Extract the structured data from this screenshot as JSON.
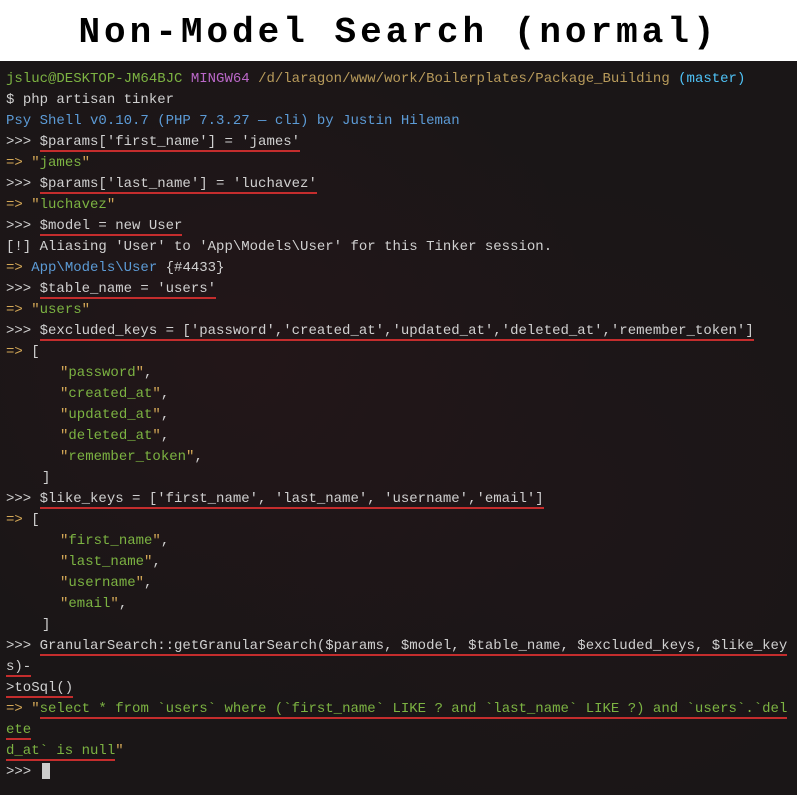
{
  "title": "Non-Model Search (normal)",
  "prompt": {
    "user": "jsluc@DESKTOP-JM64BJC",
    "system": "MINGW64",
    "path": "/d/laragon/www/work/Boilerplates/Package_Building",
    "branch": "(master)"
  },
  "cmd_prefix": "$ ",
  "cmd": "php artisan tinker",
  "psy_shell": "Psy Shell v0.10.7 (PHP 7.3.27 — cli) by Justin Hileman",
  "repl_prompt": ">>> ",
  "arrow": "=> ",
  "lines": {
    "l1": "$params['first_name'] = 'james'",
    "l1r_open": "\"",
    "l1r_val": "james",
    "l1r_close": "\"",
    "l2": "$params['last_name'] = 'luchavez'",
    "l2r_val": "luchavez",
    "l3": "$model = new User",
    "alias_prefix": "[!] ",
    "alias": "Aliasing 'User' to 'App\\Models\\User' for this Tinker session.",
    "l3r_class": "App\\Models\\User",
    "l3r_id": " {#4433}",
    "l4": "$table_name = 'users'",
    "l4r_val": "users",
    "l5": "$excluded_keys = ['password','created_at','updated_at','deleted_at','remember_token']",
    "arr_open": "[",
    "arr_close": "]",
    "excluded": [
      "password",
      "created_at",
      "updated_at",
      "deleted_at",
      "remember_token"
    ],
    "l6": "$like_keys = ['first_name', 'last_name', 'username','email']",
    "like": [
      "first_name",
      "last_name",
      "username",
      "email"
    ],
    "l7a": "GranularSearch::getGranularSearch($params, $model, $table_name, $excluded_keys, $like_keys)-",
    "l7b": ">toSql()",
    "sql_a": "select * from `users` where (`first_name` LIKE ? and `last_name` LIKE ?) and `users`.`delete",
    "sql_b": "d_at` is null",
    "comma": ",",
    "quote": "\""
  }
}
